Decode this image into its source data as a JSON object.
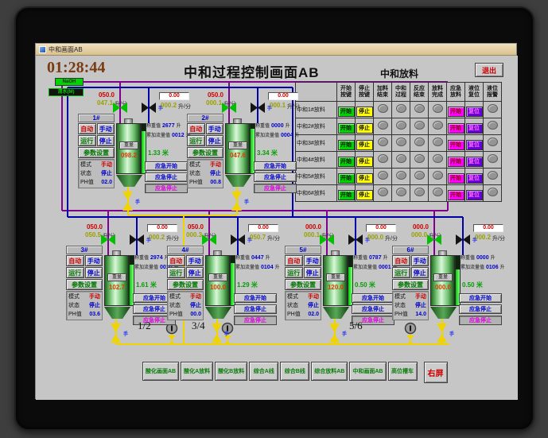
{
  "window": {
    "title": "中和画面AB"
  },
  "header": {
    "time": "01:28:44",
    "title": "中和过程控制画面AB"
  },
  "badges": [
    {
      "label": "NaOH"
    },
    {
      "label": "清水(M)"
    }
  ],
  "discharge_table": {
    "title": "中和放料",
    "exit_label": "退出",
    "columns": [
      "开始\n按键",
      "停止\n按键",
      "加料\n结束",
      "中和\n过程",
      "反应\n结束",
      "放料\n完成",
      "应急\n放料",
      "液位\n复位",
      "液位\n报警"
    ],
    "rows": [
      {
        "label": "中和1#放料"
      },
      {
        "label": "中和2#放料"
      },
      {
        "label": "中和3#放料"
      },
      {
        "label": "中和4#放料"
      },
      {
        "label": "中和5#放料"
      },
      {
        "label": "中和6#放料"
      }
    ],
    "cell_labels": {
      "start": "开始",
      "stop": "停止",
      "emergency": "开始",
      "reset": "复位"
    }
  },
  "tank_labels": {
    "auto": "自动",
    "manual": "手动",
    "run": "运行",
    "stop": "停止",
    "params": "参数设置",
    "mode": "模式",
    "state": "状态",
    "ph": "PH值",
    "mode_value": "手动",
    "state_value": "停止",
    "weigh": "称重值",
    "accum": "累加流量值",
    "flow_unit": "升/分",
    "vol_unit": "升",
    "level_unit": "米",
    "tank_button": "重量",
    "em_start": "应急开始",
    "em_stop": "应急停止",
    "em_stop2": "应急停止",
    "valve_tag": "手"
  },
  "tanks": [
    {
      "id": "1#",
      "set_flow": "050.0",
      "act_flow": "047.1",
      "box_set": "0.00",
      "box_act": "000.2",
      "weigh": "2677",
      "accum": "0012",
      "weight": "098.2",
      "level": "1.33",
      "ph": "02.0",
      "level_pct": 85
    },
    {
      "id": "2#",
      "set_flow": "050.0",
      "act_flow": "000.1",
      "box_set": "0.00",
      "box_act": "000.1",
      "weigh": "0000",
      "accum": "0004",
      "weight": "047.6",
      "level": "3.34",
      "ph": "00.8",
      "level_pct": 90
    },
    {
      "id": "3#",
      "set_flow": "050.0",
      "act_flow": "050.5",
      "box_set": "0.00",
      "box_act": "000.2",
      "weigh": "2974",
      "accum": "0010",
      "weight": "102.7",
      "level": "1.61",
      "ph": "03.6",
      "level_pct": 82
    },
    {
      "id": "4#",
      "set_flow": "050.0",
      "act_flow": "000.3",
      "box_set": "0.00",
      "box_act": "050.7",
      "weigh": "0447",
      "accum": "0104",
      "weight": "100.0",
      "level": "1.29",
      "ph": "00.0",
      "level_pct": 85
    },
    {
      "id": "5#",
      "set_flow": "000.0",
      "act_flow": "000.1",
      "box_set": "0.00",
      "box_act": "000.0",
      "weigh": "0787",
      "accum": "0001",
      "weight": "120.0",
      "level": "0.50",
      "ph": "02.0",
      "level_pct": 78
    },
    {
      "id": "6#",
      "set_flow": "000.0",
      "act_flow": "000.0",
      "box_set": "0.00",
      "box_act": "000.2",
      "weigh": "0000",
      "accum": "0106",
      "weight": "000.0",
      "level": "0.50",
      "ph": "14.0",
      "level_pct": 72
    }
  ],
  "pumps": {
    "labels": [
      "1/2",
      "3/4",
      "5/6"
    ]
  },
  "nav": {
    "buttons": [
      {
        "label": "酸化画面AB"
      },
      {
        "label": "酸化A放料"
      },
      {
        "label": "酸化B放料"
      },
      {
        "label": "综合A线"
      },
      {
        "label": "综合B线"
      },
      {
        "label": "综合放料AB"
      },
      {
        "label": "中和画面AB"
      },
      {
        "label": "高位槽车"
      },
      {
        "label": "右屏",
        "accent": true
      }
    ]
  },
  "colors": {
    "pipe_purple": "#800090",
    "pipe_blue": "#0000a8",
    "pipe_yellow": "#f0d400",
    "valve_green": "#00c000",
    "valve_black": "#141414",
    "btn_green": "#00d400",
    "btn_yellow": "#ffff00",
    "btn_magenta": "#ff00ff",
    "btn_purple": "#6a00d8",
    "screen_bg": "#c6c6c6",
    "accent_red": "#cc0000"
  }
}
